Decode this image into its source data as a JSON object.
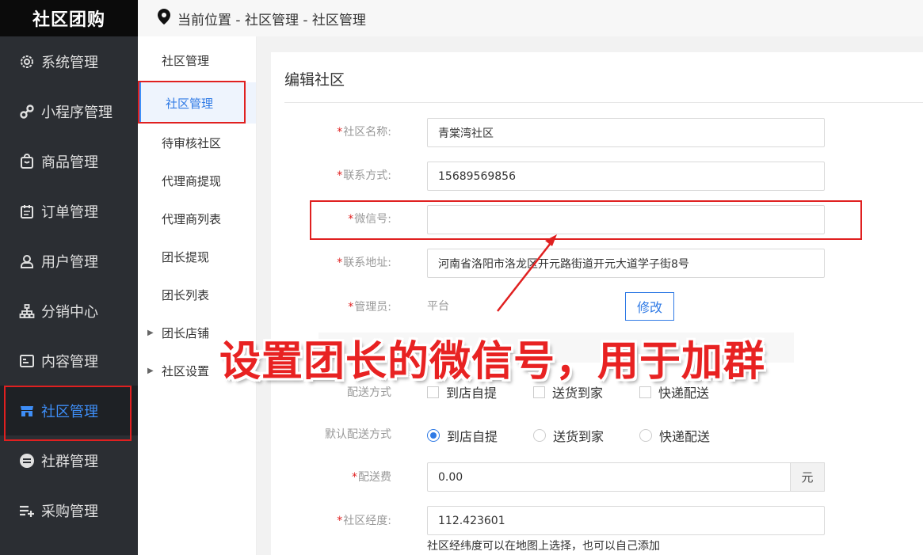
{
  "app": {
    "title": "社区团购"
  },
  "breadcrumb": "当前位置 - 社区管理 - 社区管理",
  "sidebar": {
    "items": [
      {
        "label": "系统管理",
        "icon": "gear-icon"
      },
      {
        "label": "小程序管理",
        "icon": "link-icon"
      },
      {
        "label": "商品管理",
        "icon": "bag-icon"
      },
      {
        "label": "订单管理",
        "icon": "calendar-icon"
      },
      {
        "label": "用户管理",
        "icon": "user-icon"
      },
      {
        "label": "分销中心",
        "icon": "org-chart-icon"
      },
      {
        "label": "内容管理",
        "icon": "document-icon"
      },
      {
        "label": "社区管理",
        "icon": "store-icon",
        "active": true
      },
      {
        "label": "社群管理",
        "icon": "group-icon"
      },
      {
        "label": "采购管理",
        "icon": "add-list-icon"
      }
    ]
  },
  "submenu": {
    "items": [
      {
        "label": "社区管理"
      },
      {
        "label": "社区管理",
        "active": true
      },
      {
        "label": "待审核社区"
      },
      {
        "label": "代理商提现"
      },
      {
        "label": "代理商列表"
      },
      {
        "label": "团长提现"
      },
      {
        "label": "团长列表"
      },
      {
        "label": "团长店铺",
        "expandable": true
      },
      {
        "label": "社区设置",
        "expandable": true
      }
    ]
  },
  "form": {
    "title": "编辑社区",
    "name": {
      "label": "社区名称:",
      "value": "青棠湾社区"
    },
    "phone": {
      "label": "联系方式:",
      "value": "15689569856"
    },
    "wechat": {
      "label": "微信号:",
      "value": ""
    },
    "address": {
      "label": "联系地址:",
      "value": "河南省洛阳市洛龙区开元路街道开元大道学子街8号"
    },
    "admin": {
      "label": "管理员:",
      "value": "平台",
      "button": "修改"
    },
    "delivery": {
      "label": "配送方式",
      "options": [
        "到店自提",
        "送货到家",
        "快递配送"
      ]
    },
    "default_delivery": {
      "label": "默认配送方式",
      "options": [
        "到店自提",
        "送货到家",
        "快递配送"
      ],
      "selected": 0
    },
    "fee": {
      "label": "配送费",
      "value": "0.00",
      "unit": "元"
    },
    "longitude": {
      "label": "社区经度:",
      "value": "112.423601",
      "hint": "社区经纬度可以在地图上选择，也可以自己添加"
    }
  },
  "annotation": {
    "text": "设置团长的微信号，用于加群"
  },
  "colors": {
    "accent": "#2f7ae5",
    "highlight": "#e02020",
    "sidebar_bg": "#2b2e33"
  }
}
